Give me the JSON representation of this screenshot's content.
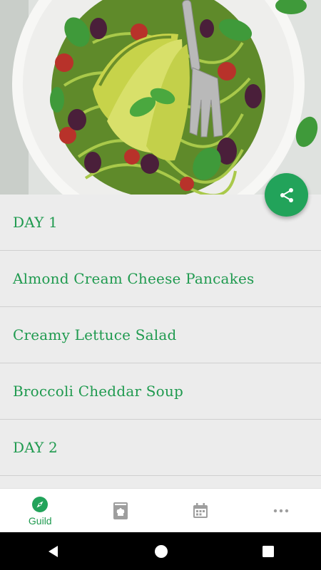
{
  "hero": {
    "image": "zucchini-noodle-avocado-salad-bowl"
  },
  "fab": {
    "icon": "share-icon"
  },
  "list": {
    "items": [
      {
        "label": "DAY 1"
      },
      {
        "label": "Almond Cream Cheese Pancakes"
      },
      {
        "label": "Creamy Lettuce Salad"
      },
      {
        "label": "Broccoli Cheddar Soup"
      },
      {
        "label": "DAY 2"
      }
    ]
  },
  "bottom_nav": {
    "items": [
      {
        "icon": "compass-icon",
        "label": "Guild",
        "active": true
      },
      {
        "icon": "recipe-book-icon",
        "label": ""
      },
      {
        "icon": "calendar-icon",
        "label": ""
      },
      {
        "icon": "more-icon",
        "label": ""
      }
    ]
  },
  "colors": {
    "accent": "#22a35a",
    "text_green": "#1f9a4f",
    "inactive_icon": "#9e9e9e"
  }
}
